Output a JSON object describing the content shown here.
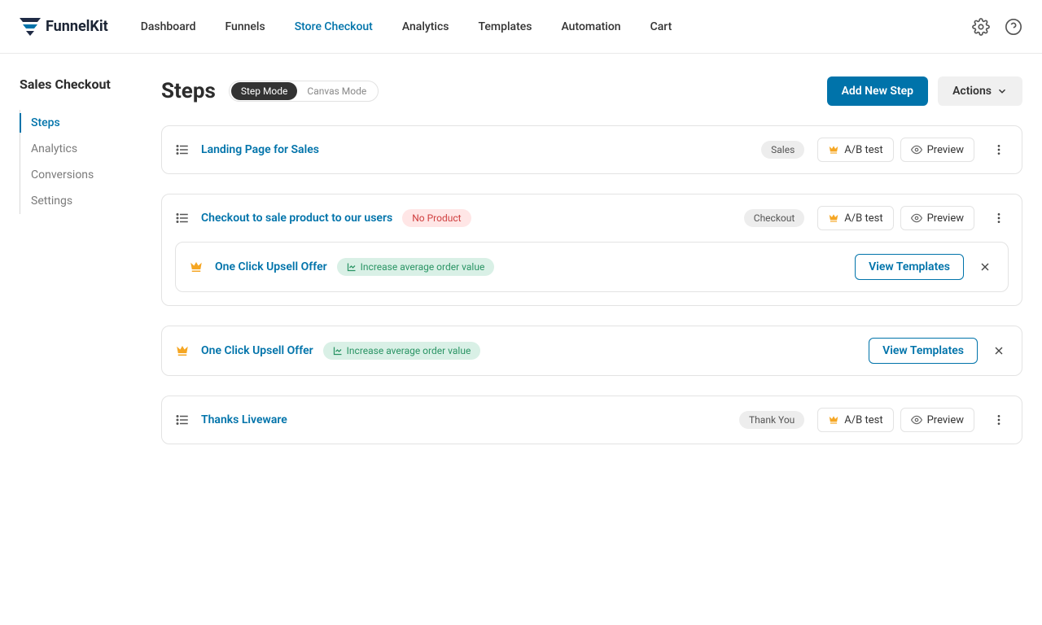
{
  "logo": {
    "text": "FunnelKit"
  },
  "nav": {
    "items": [
      "Dashboard",
      "Funnels",
      "Store Checkout",
      "Analytics",
      "Templates",
      "Automation",
      "Cart"
    ],
    "activeIndex": 2
  },
  "sidebar": {
    "title": "Sales Checkout",
    "items": [
      "Steps",
      "Analytics",
      "Conversions",
      "Settings"
    ],
    "activeIndex": 0
  },
  "page": {
    "title": "Steps",
    "modes": [
      "Step Mode",
      "Canvas Mode"
    ],
    "activeModeIndex": 0,
    "addStepLabel": "Add New Step",
    "actionsLabel": "Actions"
  },
  "labels": {
    "abTest": "A/B test",
    "preview": "Preview",
    "viewTemplates": "View Templates",
    "noProduct": "No Product",
    "increaseAOV": "Increase average order value"
  },
  "steps": [
    {
      "title": "Landing Page for Sales",
      "typeTag": "Sales"
    },
    {
      "title": "Checkout to sale product to our users",
      "typeTag": "Checkout",
      "warn": true,
      "nestedUpsell": {
        "title": "One Click Upsell Offer"
      }
    },
    {
      "upsell": true,
      "title": "One Click Upsell Offer"
    },
    {
      "title": "Thanks Liveware",
      "typeTag": "Thank You"
    }
  ]
}
